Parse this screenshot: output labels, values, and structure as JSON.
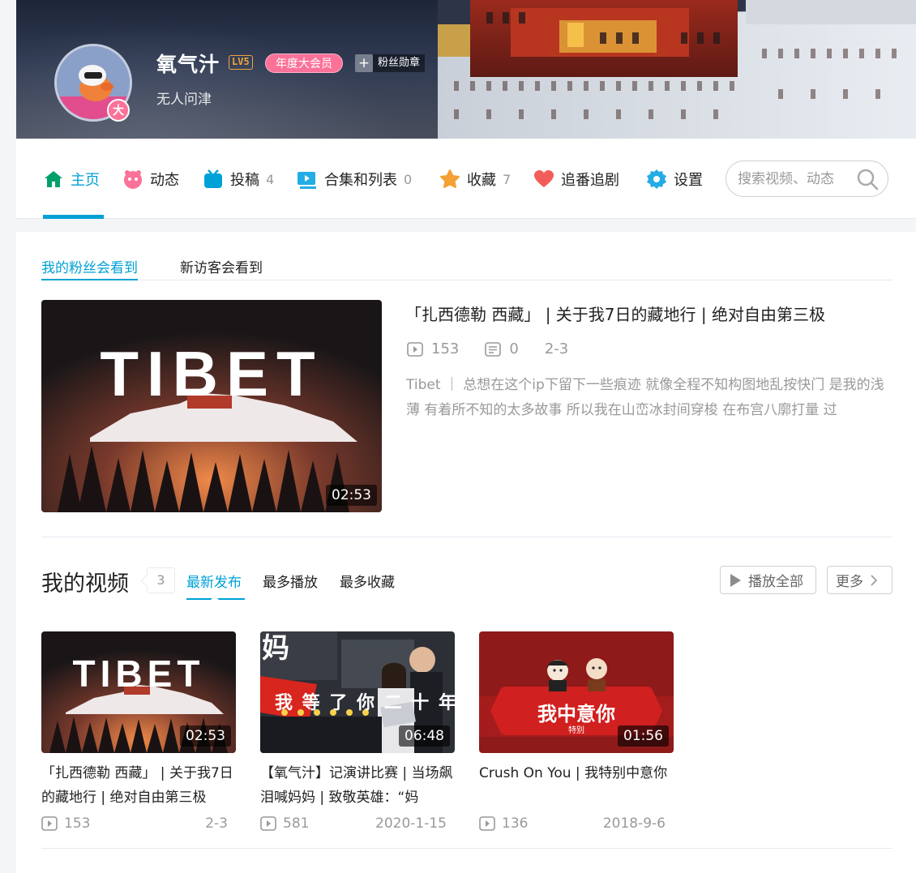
{
  "profile": {
    "username": "氧气汁",
    "level": "LV5",
    "vip_label": "年度大会员",
    "medal_label": "粉丝勋章",
    "medal_plus": "+",
    "signature": "无人问津",
    "avatar_badge": "大"
  },
  "nav": {
    "items": [
      {
        "label": "主页",
        "icon": "home-icon",
        "count": ""
      },
      {
        "label": "动态",
        "icon": "dynamic-icon",
        "count": ""
      },
      {
        "label": "投稿",
        "icon": "upload-tv-icon",
        "count": "4"
      },
      {
        "label": "合集和列表",
        "icon": "collection-icon",
        "count": "0"
      },
      {
        "label": "收藏",
        "icon": "star-icon",
        "count": "7"
      },
      {
        "label": "追番追剧",
        "icon": "heart-icon",
        "count": ""
      },
      {
        "label": "设置",
        "icon": "gear-icon",
        "count": ""
      }
    ],
    "search_placeholder": "搜索视频、动态",
    "colors": {
      "active": "#00a1d6",
      "pink": "#fb7299"
    }
  },
  "featured": {
    "tabs": [
      "我的粉丝会看到",
      "新访客会看到"
    ],
    "title": "「扎西德勒 西藏」 | 关于我7日的藏地行 | 绝对自由第三极",
    "plays": "153",
    "comments": "0",
    "date": "2-3",
    "description": "Tibet ｜ 总想在这个ip下留下一些痕迹 就像全程不知构图地乱按快门 是我的浅薄 有着所不知的太多故事 所以我在山峦冰封间穿梭 在布宫八廓打量 过",
    "duration": "02:53",
    "thumb_text": "TIBET"
  },
  "videos_section": {
    "title": "我的视频",
    "count": "3",
    "tabs": [
      "最新发布",
      "最多播放",
      "最多收藏"
    ],
    "play_all_label": "播放全部",
    "more_label": "更多",
    "videos": [
      {
        "title": "「扎西德勒 西藏」 | 关于我7日的藏地行 | 绝对自由第三极",
        "plays": "153",
        "date": "2-3",
        "duration": "02:53",
        "thumb_text": "TIBET"
      },
      {
        "title": "【氧气汁】记演讲比赛 | 当场飙泪喊妈妈 | 致敬英雄：“妈",
        "plays": "581",
        "date": "2020-1-15",
        "duration": "06:48",
        "thumb_text": "我 等 了 你 二 十 年",
        "thumb_text2": "妈"
      },
      {
        "title": "Crush On You | 我特别中意你",
        "plays": "136",
        "date": "2018-9-6",
        "duration": "01:56",
        "thumb_text": "我中意你",
        "thumb_text2": "特别"
      }
    ]
  }
}
